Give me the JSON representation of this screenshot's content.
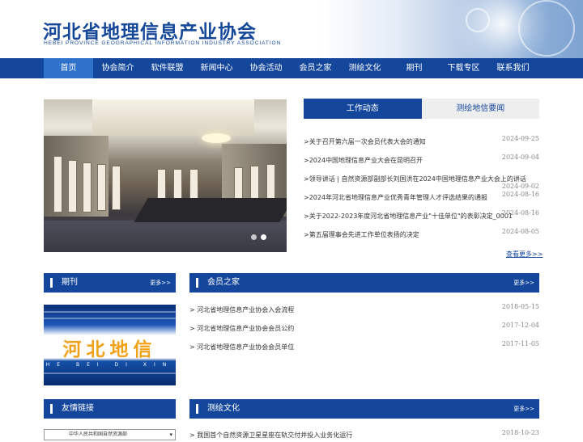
{
  "header": {
    "title_cn": "河北省地理信息产业协会",
    "title_en": "HEBEI   PROVINCE   GEOGRAPHICAL   INFORMATION   INDUSTRY   ASSOCIATION"
  },
  "nav": {
    "items": [
      "首页",
      "协会简介",
      "软件联盟",
      "新闻中心",
      "协会活动",
      "会员之家",
      "测绘文化",
      "期刊",
      "下载专区",
      "联系我们"
    ],
    "active_index": 0
  },
  "news": {
    "tabs": [
      "工作动态",
      "测绘地信要闻"
    ],
    "items": [
      {
        "title": ">关于召开第六届一次会员代表大会的通知",
        "date": "2024-09-25"
      },
      {
        "title": ">2024中国地理信息产业大会在昆明召开",
        "date": "2024-09-04"
      },
      {
        "title": ">领导讲话 | 自然资源部副部长刘国洪在2024中国地理信息产业大会上的讲话",
        "date": "2024-09-02"
      },
      {
        "title": ">2024年河北省地理信息产业优秀青年管理人才评选结果的通报",
        "date": "2024-08-16"
      },
      {
        "title": ">关于2022-2023年度河北省地理信息产业\"十佳单位\"的表彰决定_0001",
        "date": "2024-08-16"
      },
      {
        "title": ">第五届理事会先进工作单位表扬的决定",
        "date": "2024-08-05"
      }
    ],
    "more": "查看更多>>"
  },
  "journal": {
    "title": "期刊",
    "more": "更多>>",
    "cover_cn": "河北地信",
    "cover_en": "HE BEI DI XIN"
  },
  "members": {
    "title": "会员之家",
    "more": "更多>>",
    "items": [
      {
        "title": "> 河北省地理信息产业协会入会流程",
        "date": "2018-05-15"
      },
      {
        "title": "> 河北省地理信息产业协会会员公约",
        "date": "2017-12-04"
      },
      {
        "title": "> 河北省地理信息产业协会会员单位",
        "date": "2017-11-05"
      }
    ]
  },
  "links": {
    "title": "友情链接",
    "select_value": "中华人民共和国自然资源部"
  },
  "culture": {
    "title": "测绘文化",
    "more": "更多>>",
    "items": [
      {
        "title": "> 我国首个自然资源卫星星座在轨交付并投入业务化运行",
        "date": "2018-10-23"
      }
    ]
  },
  "colors": {
    "brand": "#14479b",
    "nav_active": "#2e73c9"
  }
}
